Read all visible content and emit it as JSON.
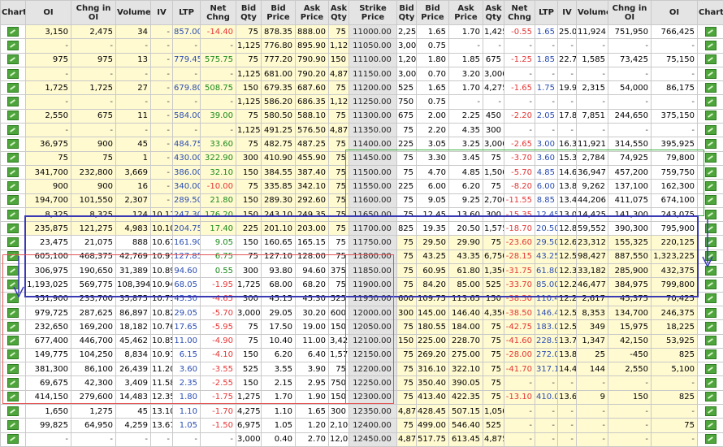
{
  "headers": [
    "Chart",
    "OI",
    "Chng in OI",
    "Volume",
    "IV",
    "LTP",
    "Net Chng",
    "Bid Qty",
    "Bid Price",
    "Ask Price",
    "Ask Qty",
    "Strike Price",
    "Bid Qty",
    "Bid Price",
    "Ask Price",
    "Ask Qty",
    "Net Chng",
    "LTP",
    "IV",
    "Volume",
    "Chng in OI",
    "OI",
    "Chart"
  ],
  "rows": [
    {
      "s": "11000.00",
      "c": [
        "3,150",
        "2,475",
        "34",
        "-",
        "857.00",
        "-14.40",
        "75",
        "878.35",
        "888.00",
        "75"
      ],
      "p": [
        "2,250",
        "1.65",
        "1.70",
        "1,425",
        "-0.55",
        "1.65",
        "25.09",
        "11,924",
        "751,950",
        "766,425"
      ]
    },
    {
      "s": "11050.00",
      "c": [
        "-",
        "-",
        "-",
        "-",
        "-",
        "-",
        "1,125",
        "776.80",
        "895.90",
        "1,125"
      ],
      "p": [
        "3,000",
        "0.75",
        "-",
        "-",
        "-",
        "-",
        "-",
        "-",
        "-",
        "-"
      ]
    },
    {
      "s": "11100.00",
      "c": [
        "975",
        "975",
        "13",
        "-",
        "779.45",
        "575.75",
        "75",
        "777.20",
        "790.90",
        "150"
      ],
      "p": [
        "1,200",
        "1.80",
        "1.85",
        "675",
        "-1.25",
        "1.85",
        "22.72",
        "1,585",
        "73,425",
        "75,150"
      ]
    },
    {
      "s": "11150.00",
      "c": [
        "-",
        "-",
        "-",
        "-",
        "-",
        "-",
        "1,125",
        "681.00",
        "790.20",
        "4,875"
      ],
      "p": [
        "3,000",
        "0.70",
        "3.20",
        "3,000",
        "-",
        "-",
        "-",
        "-",
        "-",
        "-"
      ]
    },
    {
      "s": "11200.00",
      "c": [
        "1,725",
        "1,725",
        "27",
        "-",
        "679.80",
        "508.75",
        "150",
        "679.35",
        "687.60",
        "75"
      ],
      "p": [
        "525",
        "1.65",
        "1.70",
        "4,275",
        "-1.65",
        "1.75",
        "19.98",
        "2,315",
        "54,000",
        "86,175"
      ]
    },
    {
      "s": "11250.00",
      "c": [
        "-",
        "-",
        "-",
        "-",
        "-",
        "-",
        "1,125",
        "586.20",
        "686.35",
        "1,125"
      ],
      "p": [
        "750",
        "0.75",
        "-",
        "-",
        "-",
        "-",
        "-",
        "-",
        "-",
        "-"
      ]
    },
    {
      "s": "11300.00",
      "c": [
        "2,550",
        "675",
        "11",
        "-",
        "584.00",
        "39.00",
        "75",
        "580.50",
        "588.10",
        "75"
      ],
      "p": [
        "675",
        "2.00",
        "2.25",
        "450",
        "-2.20",
        "2.05",
        "17.89",
        "7,851",
        "244,650",
        "375,150"
      ]
    },
    {
      "s": "11350.00",
      "c": [
        "-",
        "-",
        "-",
        "-",
        "-",
        "-",
        "1,125",
        "491.25",
        "576.50",
        "4,875"
      ],
      "p": [
        "75",
        "2.20",
        "4.35",
        "300",
        "-",
        "-",
        "-",
        "-",
        "-",
        "-"
      ]
    },
    {
      "s": "11400.00",
      "c": [
        "36,975",
        "900",
        "45",
        "-",
        "484.75",
        "33.60",
        "75",
        "482.75",
        "487.25",
        "75"
      ],
      "p": [
        "225",
        "3.05",
        "3.25",
        "3,000",
        "-2.65",
        "3.00",
        "16.39",
        "11,921",
        "314,550",
        "395,925"
      ]
    },
    {
      "s": "11450.00",
      "c": [
        "75",
        "75",
        "1",
        "-",
        "430.00",
        "322.90",
        "300",
        "410.90",
        "455.90",
        "75"
      ],
      "p": [
        "75",
        "3.30",
        "3.45",
        "75",
        "-3.70",
        "3.60",
        "15.37",
        "2,784",
        "74,925",
        "79,800"
      ]
    },
    {
      "s": "11500.00",
      "c": [
        "341,700",
        "232,800",
        "3,669",
        "-",
        "386.00",
        "32.10",
        "150",
        "384.55",
        "387.40",
        "75"
      ],
      "p": [
        "75",
        "4.70",
        "4.85",
        "1,500",
        "-5.70",
        "4.85",
        "14.69",
        "36,947",
        "457,200",
        "759,750"
      ]
    },
    {
      "s": "11550.00",
      "c": [
        "900",
        "900",
        "16",
        "-",
        "340.00",
        "-10.00",
        "75",
        "335.85",
        "342.10",
        "75"
      ],
      "p": [
        "225",
        "6.00",
        "6.20",
        "75",
        "-8.20",
        "6.00",
        "13.86",
        "9,262",
        "137,100",
        "162,300"
      ]
    },
    {
      "s": "11600.00",
      "c": [
        "194,700",
        "101,550",
        "2,307",
        "-",
        "289.50",
        "21.80",
        "150",
        "289.30",
        "292.60",
        "75"
      ],
      "p": [
        "75",
        "9.05",
        "9.25",
        "2,700",
        "-11.55",
        "8.85",
        "13.48",
        "44,206",
        "411,075",
        "674,100"
      ]
    },
    {
      "s": "11650.00",
      "c": [
        "8,325",
        "8,325",
        "124",
        "10.11",
        "247.30",
        "176.20",
        "150",
        "243.10",
        "249.35",
        "75"
      ],
      "p": [
        "75",
        "12.45",
        "13.60",
        "300",
        "-15.35",
        "12.45",
        "13.08",
        "14,425",
        "141,300",
        "243,075"
      ]
    },
    {
      "s": "11700.00",
      "c": [
        "235,875",
        "121,275",
        "4,983",
        "10.10",
        "204.75",
        "17.40",
        "225",
        "201.10",
        "203.00",
        "75"
      ],
      "p": [
        "825",
        "19.35",
        "20.50",
        "1,575",
        "-18.70",
        "20.50",
        "12.86",
        "59,552",
        "390,300",
        "795,900"
      ]
    },
    {
      "s": "11750.00",
      "c": [
        "23,475",
        "21,075",
        "888",
        "10.67",
        "161.90",
        "9.05",
        "150",
        "160.65",
        "165.15",
        "75"
      ],
      "p": [
        "75",
        "29.50",
        "29.90",
        "75",
        "-23.60",
        "29.50",
        "12.64",
        "23,312",
        "155,325",
        "220,125"
      ]
    },
    {
      "s": "11800.00",
      "c": [
        "605,100",
        "468,375",
        "42,769",
        "10.97",
        "127.85",
        "6.75",
        "75",
        "127.10",
        "128.00",
        "75"
      ],
      "p": [
        "75",
        "43.25",
        "43.35",
        "6,750",
        "-28.15",
        "43.25",
        "12.52",
        "98,427",
        "887,550",
        "1,323,225"
      ]
    },
    {
      "s": "11850.00",
      "c": [
        "306,975",
        "190,650",
        "31,389",
        "10.89",
        "94.60",
        "0.55",
        "300",
        "93.80",
        "94.60",
        "375"
      ],
      "p": [
        "75",
        "60.95",
        "61.80",
        "1,350",
        "-31.75",
        "61.80",
        "12.37",
        "33,182",
        "285,900",
        "432,375"
      ]
    },
    {
      "s": "11900.00",
      "c": [
        "1,193,025",
        "569,775",
        "108,394",
        "10.94",
        "68.05",
        "-1.95",
        "1,725",
        "68.00",
        "68.20",
        "75"
      ],
      "p": [
        "75",
        "84.20",
        "85.00",
        "525",
        "-33.70",
        "85.00",
        "12.29",
        "46,477",
        "384,975",
        "799,800"
      ]
    },
    {
      "s": "11950.00",
      "c": [
        "351,900",
        "233,700",
        "35,875",
        "10.75",
        "45.30",
        "-4.65",
        "300",
        "45.15",
        "45.30",
        "525"
      ],
      "p": [
        "600",
        "109.75",
        "113.65",
        "150",
        "-38.50",
        "110.40",
        "12.28",
        "2,617",
        "45,375",
        "70,425"
      ]
    },
    {
      "s": "12000.00",
      "c": [
        "979,725",
        "287,625",
        "86,897",
        "10.82",
        "29.05",
        "-5.70",
        "3,000",
        "29.05",
        "30.20",
        "600"
      ],
      "p": [
        "300",
        "145.00",
        "146.40",
        "4,350",
        "-38.50",
        "146.40",
        "12.54",
        "8,353",
        "134,700",
        "246,375"
      ]
    },
    {
      "s": "12050.00",
      "c": [
        "232,650",
        "169,200",
        "18,182",
        "10.76",
        "17.65",
        "-5.95",
        "75",
        "17.50",
        "19.00",
        "150"
      ],
      "p": [
        "75",
        "180.55",
        "184.00",
        "75",
        "-42.75",
        "183.00",
        "12.54",
        "349",
        "15,975",
        "18,225"
      ]
    },
    {
      "s": "12100.00",
      "c": [
        "677,400",
        "446,700",
        "45,462",
        "10.85",
        "11.00",
        "-4.90",
        "75",
        "10.40",
        "11.00",
        "3,425"
      ],
      "p": [
        "150",
        "225.00",
        "228.70",
        "75",
        "-41.60",
        "228.90",
        "13.79",
        "1,347",
        "42,150",
        "53,925"
      ]
    },
    {
      "s": "12150.00",
      "c": [
        "149,775",
        "104,250",
        "8,834",
        "10.91",
        "6.15",
        "-4.10",
        "150",
        "6.20",
        "6.40",
        "1,575"
      ],
      "p": [
        "75",
        "269.20",
        "275.00",
        "75",
        "-28.00",
        "272.00",
        "13.80",
        "25",
        "-450",
        "825"
      ]
    },
    {
      "s": "12200.00",
      "c": [
        "381,300",
        "86,100",
        "26,439",
        "11.20",
        "3.60",
        "-3.55",
        "525",
        "3.55",
        "3.90",
        "75"
      ],
      "p": [
        "75",
        "316.10",
        "322.10",
        "75",
        "-41.70",
        "317.10",
        "14.49",
        "144",
        "2,550",
        "5,100"
      ]
    },
    {
      "s": "12250.00",
      "c": [
        "69,675",
        "42,300",
        "3,409",
        "11.58",
        "2.35",
        "-2.55",
        "150",
        "2.15",
        "2.95",
        "750"
      ],
      "p": [
        "75",
        "350.40",
        "390.05",
        "75",
        "-",
        "-",
        "-",
        "-",
        "-",
        "-"
      ]
    },
    {
      "s": "12300.00",
      "c": [
        "414,150",
        "279,600",
        "14,483",
        "12.35",
        "1.80",
        "-1.75",
        "1,275",
        "1.70",
        "1.90",
        "150"
      ],
      "p": [
        "75",
        "413.40",
        "422.35",
        "75",
        "-13.10",
        "410.00",
        "13.65",
        "9",
        "150",
        "825"
      ]
    },
    {
      "s": "12350.00",
      "c": [
        "1,650",
        "1,275",
        "45",
        "13.10",
        "1.10",
        "-1.70",
        "4,275",
        "1.10",
        "1.65",
        "300"
      ],
      "p": [
        "4,875",
        "428.45",
        "507.15",
        "1,050",
        "-",
        "-",
        "-",
        "-",
        "-",
        "-"
      ]
    },
    {
      "s": "12400.00",
      "c": [
        "99,825",
        "64,950",
        "4,259",
        "13.67",
        "1.05",
        "-1.50",
        "6,975",
        "1.05",
        "1.20",
        "2,100"
      ],
      "p": [
        "75",
        "499.00",
        "546.40",
        "525",
        "-",
        "-",
        "-",
        "-",
        "-",
        "75"
      ]
    },
    {
      "s": "12450.00",
      "c": [
        "-",
        "-",
        "-",
        "-",
        "-",
        "-",
        "3,000",
        "0.40",
        "2.70",
        "12,000"
      ],
      "p": [
        "4,875",
        "517.75",
        "613.45",
        "4,875",
        "-",
        "-",
        "-",
        "-",
        "-",
        "-"
      ]
    }
  ]
}
